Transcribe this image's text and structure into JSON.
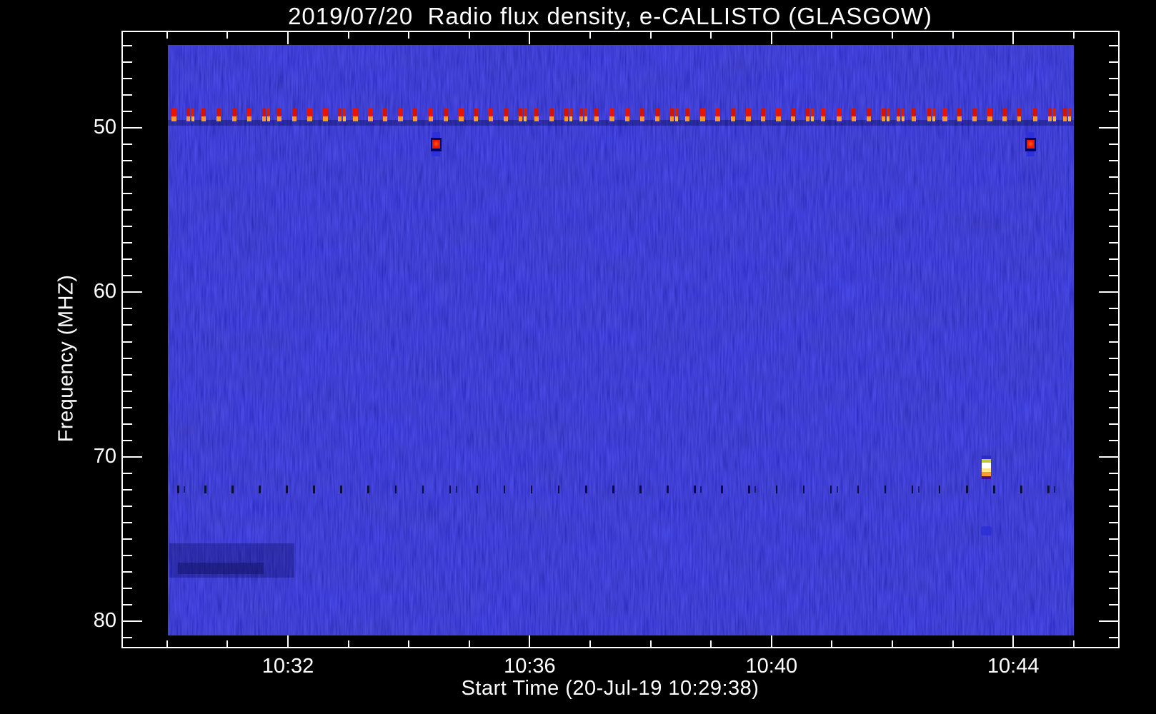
{
  "chart_data": {
    "type": "heatmap",
    "subtype": "radio-spectrogram",
    "title": "2019/07/20  Radio flux density, e-CALLISTO (GLASGOW)",
    "xlabel": "Start Time (20-Jul-19 10:29:38)",
    "ylabel": "Frequency (MHZ)",
    "x_axis": {
      "start_time": "10:29:38",
      "major_ticks": [
        "10:32",
        "10:36",
        "10:40",
        "10:44"
      ],
      "minor_tick_step_minutes": 1,
      "major_tick_step_minutes": 4
    },
    "y_axis": {
      "unit": "MHZ",
      "major_ticks": [
        50,
        60,
        70,
        80
      ],
      "minor_tick_step_mhz": 1,
      "range_mhz": [
        44.2,
        81.7
      ],
      "orientation": "frequency increases downward"
    },
    "image": {
      "time_span": [
        "10:30:00",
        "10:45:00"
      ],
      "freq_span_mhz": [
        45,
        81
      ],
      "base_color": "#0f0fb0",
      "texture": "blue background with fine vertical noise striations"
    },
    "colors": {
      "page_background": "#000000",
      "frame": "#ffffff",
      "text": "#ffffff"
    },
    "features": [
      {
        "id": "interference-dash-line",
        "kind": "horizontal dashed line",
        "frequency_mhz": 49.2,
        "dash_period_seconds": 15,
        "dash_color_top": "#d31405",
        "dash_color_bottom": "#ff9828",
        "shadow_band_color": "rgba(0,0,50,0.32)"
      },
      {
        "id": "point-burst-1",
        "kind": "point",
        "time": "10:34:27",
        "frequency_mhz": 51.0,
        "color": "#ee1505",
        "halo_color": "#2e30dc",
        "ring_color": "#000060"
      },
      {
        "id": "point-burst-2",
        "kind": "point",
        "time": "10:44:17",
        "frequency_mhz": 51.0,
        "color": "#ee1505",
        "halo_color": "#2e30dc",
        "ring_color": "#000060"
      },
      {
        "id": "bright-burst",
        "kind": "point",
        "time": "10:43:33",
        "frequency_mhz": 70.6,
        "band_colors": [
          "#2a2cc8",
          "#c8c838",
          "#ffffff",
          "#ffe98c",
          "#ff9a30",
          "#3c1090"
        ],
        "band_heights": [
          5,
          5,
          8,
          5,
          6,
          4
        ]
      },
      {
        "id": "faint-echo",
        "kind": "point",
        "time": "10:43:33",
        "frequency_mhz": 74.5,
        "color": "#2b2fd6"
      },
      {
        "id": "dark-tick-row",
        "kind": "horizontal dashed line",
        "frequency_mhz": 72.0,
        "dash_period_seconds": 27,
        "color": "rgba(2,2,28,0.82)"
      }
    ]
  }
}
